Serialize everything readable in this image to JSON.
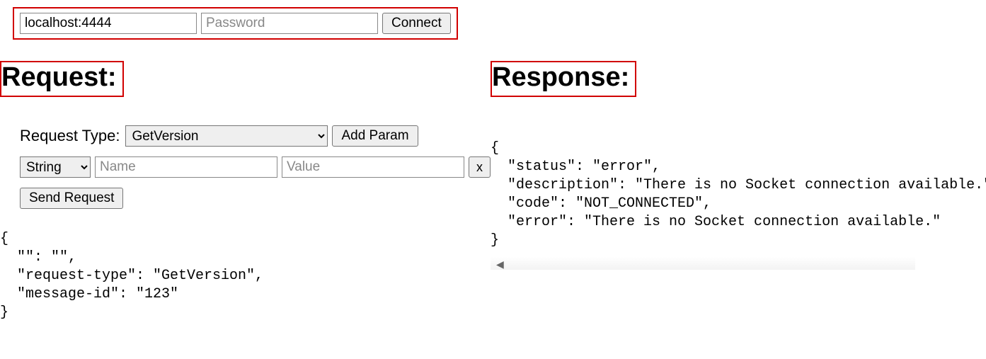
{
  "connect": {
    "host_value": "localhost:4444",
    "password_placeholder": "Password",
    "password_value": "",
    "button_label": "Connect"
  },
  "request": {
    "heading": "Request:",
    "type_label": "Request Type:",
    "type_selected": "GetVersion",
    "type_options": [
      "GetVersion"
    ],
    "add_param_label": "Add Param",
    "param": {
      "type_selected": "String",
      "type_options": [
        "String"
      ],
      "name_placeholder": "Name",
      "name_value": "",
      "value_placeholder": "Value",
      "value_value": "",
      "remove_label": "x"
    },
    "send_label": "Send Request",
    "json_text": "{\n  \"\": \"\",\n  \"request-type\": \"GetVersion\",\n  \"message-id\": \"123\"\n}"
  },
  "response": {
    "heading": "Response:",
    "json_text": "{\n  \"status\": \"error\",\n  \"description\": \"There is no Socket connection available.\",\n  \"code\": \"NOT_CONNECTED\",\n  \"error\": \"There is no Socket connection available.\"\n}"
  }
}
